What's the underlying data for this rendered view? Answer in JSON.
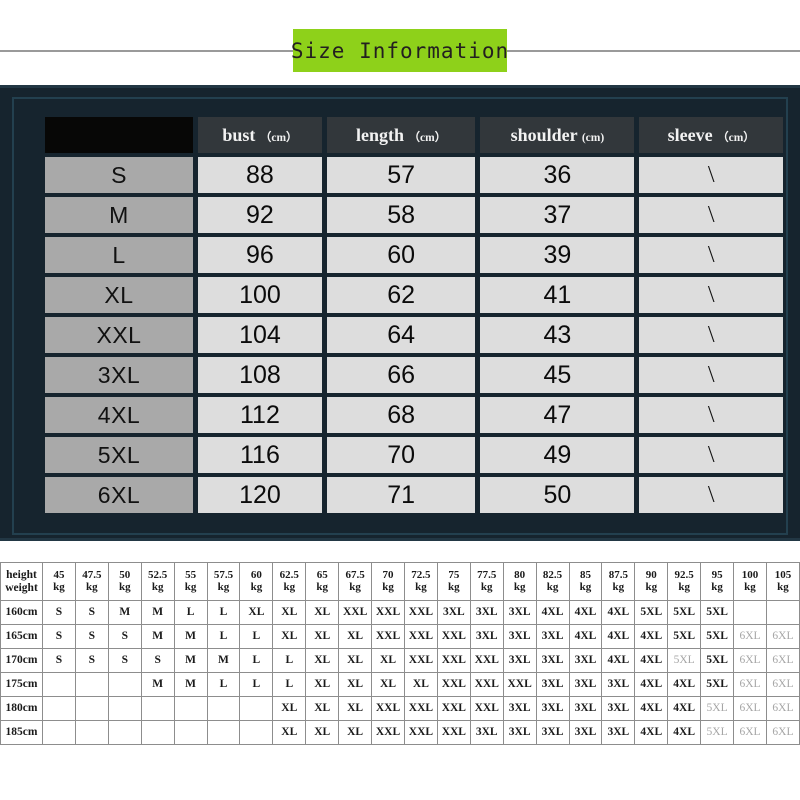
{
  "title": {
    "text": "Size Information",
    "banner_color": "#8ed11a"
  },
  "colors": {
    "panel_background": "#16242e",
    "panel_border": "#23404f",
    "header_cell": "#32373b",
    "corner_cell": "#070706",
    "size_cell": "#a9a9a9",
    "value_cell": "#dddddd",
    "faded_text": "#a6a6a6",
    "grid_line": "#8d8d8d"
  },
  "size_table": {
    "columns": [
      {
        "label": "",
        "unit": ""
      },
      {
        "label": "bust",
        "unit": "（cm）"
      },
      {
        "label": "length",
        "unit": "（cm）"
      },
      {
        "label": "shoulder",
        "unit": "(cm)"
      },
      {
        "label": "sleeve",
        "unit": "（cm）"
      }
    ],
    "rows": [
      {
        "size": "S",
        "bust": "88",
        "length": "57",
        "shoulder": "36",
        "sleeve": "\\"
      },
      {
        "size": "M",
        "bust": "92",
        "length": "58",
        "shoulder": "37",
        "sleeve": "\\"
      },
      {
        "size": "L",
        "bust": "96",
        "length": "60",
        "shoulder": "39",
        "sleeve": "\\"
      },
      {
        "size": "XL",
        "bust": "100",
        "length": "62",
        "shoulder": "41",
        "sleeve": "\\"
      },
      {
        "size": "XXL",
        "bust": "104",
        "length": "64",
        "shoulder": "43",
        "sleeve": "\\"
      },
      {
        "size": "3XL",
        "bust": "108",
        "length": "66",
        "shoulder": "45",
        "sleeve": "\\"
      },
      {
        "size": "4XL",
        "bust": "112",
        "length": "68",
        "shoulder": "47",
        "sleeve": "\\"
      },
      {
        "size": "5XL",
        "bust": "116",
        "length": "70",
        "shoulder": "49",
        "sleeve": "\\"
      },
      {
        "size": "6XL",
        "bust": "120",
        "length": "71",
        "shoulder": "50",
        "sleeve": "\\"
      }
    ]
  },
  "height_weight_table": {
    "corner_top": "height",
    "corner_bottom": "weight",
    "weight_unit": "kg",
    "weights": [
      "45",
      "47.5",
      "50",
      "52.5",
      "55",
      "57.5",
      "60",
      "62.5",
      "65",
      "67.5",
      "70",
      "72.5",
      "75",
      "77.5",
      "80",
      "82.5",
      "85",
      "87.5",
      "90",
      "92.5",
      "95",
      "100",
      "105"
    ],
    "rows": [
      {
        "height": "160cm",
        "cells": [
          "S",
          "S",
          "M",
          "M",
          "L",
          "L",
          "XL",
          "XL",
          "XL",
          "XXL",
          "XXL",
          "XXL",
          "3XL",
          "3XL",
          "3XL",
          "4XL",
          "4XL",
          "4XL",
          "5XL",
          "5XL",
          "5XL",
          "",
          ""
        ],
        "faded": [
          false,
          false,
          false,
          false,
          false,
          false,
          false,
          false,
          false,
          false,
          false,
          false,
          false,
          false,
          false,
          false,
          false,
          false,
          false,
          false,
          false,
          false,
          false
        ]
      },
      {
        "height": "165cm",
        "cells": [
          "S",
          "S",
          "S",
          "M",
          "M",
          "L",
          "L",
          "XL",
          "XL",
          "XL",
          "XXL",
          "XXL",
          "XXL",
          "3XL",
          "3XL",
          "3XL",
          "4XL",
          "4XL",
          "4XL",
          "5XL",
          "5XL",
          "6XL",
          "6XL"
        ],
        "faded": [
          false,
          false,
          false,
          false,
          false,
          false,
          false,
          false,
          false,
          false,
          false,
          false,
          false,
          false,
          false,
          false,
          false,
          false,
          false,
          false,
          false,
          true,
          true
        ]
      },
      {
        "height": "170cm",
        "cells": [
          "S",
          "S",
          "S",
          "S",
          "M",
          "M",
          "L",
          "L",
          "XL",
          "XL",
          "XL",
          "XXL",
          "XXL",
          "XXL",
          "3XL",
          "3XL",
          "3XL",
          "4XL",
          "4XL",
          "5XL",
          "5XL",
          "6XL",
          "6XL"
        ],
        "faded": [
          false,
          false,
          false,
          false,
          false,
          false,
          false,
          false,
          false,
          false,
          false,
          false,
          false,
          false,
          false,
          false,
          false,
          false,
          false,
          true,
          false,
          true,
          true
        ]
      },
      {
        "height": "175cm",
        "cells": [
          "",
          "",
          "",
          "M",
          "M",
          "L",
          "L",
          "L",
          "XL",
          "XL",
          "XL",
          "XL",
          "XXL",
          "XXL",
          "XXL",
          "3XL",
          "3XL",
          "3XL",
          "4XL",
          "4XL",
          "5XL",
          "6XL",
          "6XL"
        ],
        "faded": [
          false,
          false,
          false,
          false,
          false,
          false,
          false,
          false,
          false,
          false,
          false,
          false,
          false,
          false,
          false,
          false,
          false,
          false,
          false,
          false,
          false,
          true,
          true
        ]
      },
      {
        "height": "180cm",
        "cells": [
          "",
          "",
          "",
          "",
          "",
          "",
          "",
          "XL",
          "XL",
          "XL",
          "XXL",
          "XXL",
          "XXL",
          "XXL",
          "3XL",
          "3XL",
          "3XL",
          "3XL",
          "4XL",
          "4XL",
          "5XL",
          "6XL",
          "6XL"
        ],
        "faded": [
          false,
          false,
          false,
          false,
          false,
          false,
          false,
          false,
          false,
          false,
          false,
          false,
          false,
          false,
          false,
          false,
          false,
          false,
          false,
          false,
          true,
          true,
          true
        ]
      },
      {
        "height": "185cm",
        "cells": [
          "",
          "",
          "",
          "",
          "",
          "",
          "",
          "XL",
          "XL",
          "XL",
          "XXL",
          "XXL",
          "XXL",
          "3XL",
          "3XL",
          "3XL",
          "3XL",
          "3XL",
          "4XL",
          "4XL",
          "5XL",
          "6XL",
          "6XL"
        ],
        "faded": [
          false,
          false,
          false,
          false,
          false,
          false,
          false,
          false,
          false,
          false,
          false,
          false,
          false,
          false,
          false,
          false,
          false,
          false,
          false,
          false,
          true,
          true,
          true
        ]
      }
    ]
  }
}
